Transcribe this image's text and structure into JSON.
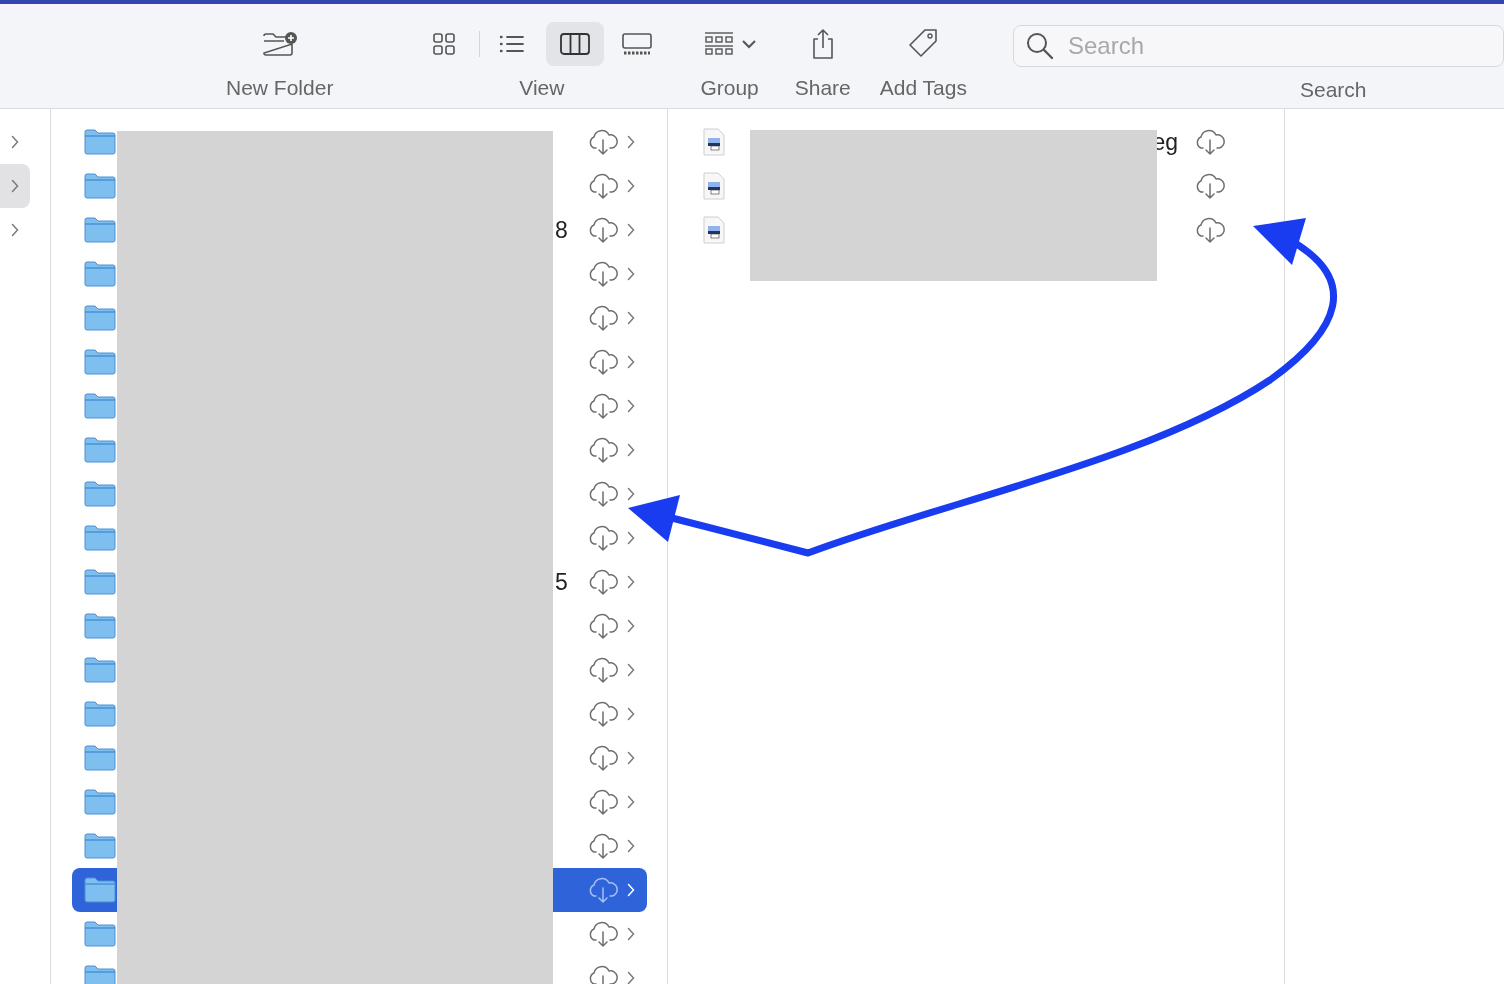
{
  "toolbar": {
    "new_folder": {
      "label": "New Folder"
    },
    "view": {
      "label": "View",
      "modes": [
        {
          "kind": "icons",
          "selected": false
        },
        {
          "kind": "list",
          "selected": false
        },
        {
          "kind": "columns",
          "selected": true
        },
        {
          "kind": "gallery",
          "selected": false
        }
      ]
    },
    "group": {
      "label": "Group"
    },
    "share": {
      "label": "Share"
    },
    "add_tags": {
      "label": "Add Tags"
    },
    "search": {
      "placeholder": "Search",
      "label": "Search"
    }
  },
  "sidebar": {
    "items": [
      {
        "selected": false
      },
      {
        "selected": true
      },
      {
        "selected": false
      }
    ]
  },
  "folders": [
    {
      "selected": false
    },
    {
      "selected": false
    },
    {
      "selected": false,
      "name_tail": "8"
    },
    {
      "selected": false
    },
    {
      "selected": false
    },
    {
      "selected": false
    },
    {
      "selected": false
    },
    {
      "selected": false
    },
    {
      "selected": false
    },
    {
      "selected": false
    },
    {
      "selected": false,
      "name_tail": "5"
    },
    {
      "selected": false
    },
    {
      "selected": false
    },
    {
      "selected": false
    },
    {
      "selected": false
    },
    {
      "selected": false
    },
    {
      "selected": false
    },
    {
      "selected": true
    },
    {
      "selected": false
    },
    {
      "selected": false
    }
  ],
  "files": [
    {
      "kind": "image",
      "name_tail": "eg"
    },
    {
      "kind": "image"
    },
    {
      "kind": "image"
    }
  ]
}
